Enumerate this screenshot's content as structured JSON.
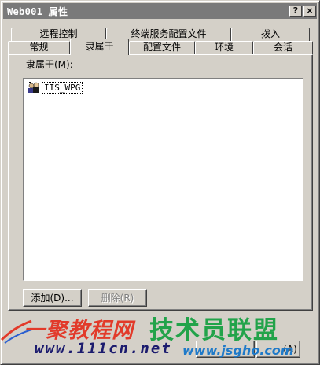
{
  "window": {
    "title": "Web001 属性",
    "help_label": "?",
    "close_label": "×"
  },
  "tabs_row1": [
    {
      "label": "远程控制"
    },
    {
      "label": "终端服务配置文件"
    },
    {
      "label": "拨入"
    }
  ],
  "tabs_row2": [
    {
      "label": "常规"
    },
    {
      "label": "隶属于",
      "active": true
    },
    {
      "label": "配置文件"
    },
    {
      "label": "环境"
    },
    {
      "label": "会话"
    }
  ],
  "member_of": {
    "label": "隶属于(M):",
    "items": [
      {
        "name": "IIS_WPG",
        "icon": "group-icon"
      }
    ]
  },
  "buttons": {
    "add": "添加(D)...",
    "remove": "删除(R)",
    "apply_partial": "(A)"
  },
  "watermark": {
    "site1": "一聚教程网",
    "site1_url": "www.111cn.net",
    "site2": "技术员联盟",
    "site2_url": "www.jsgho.com"
  }
}
